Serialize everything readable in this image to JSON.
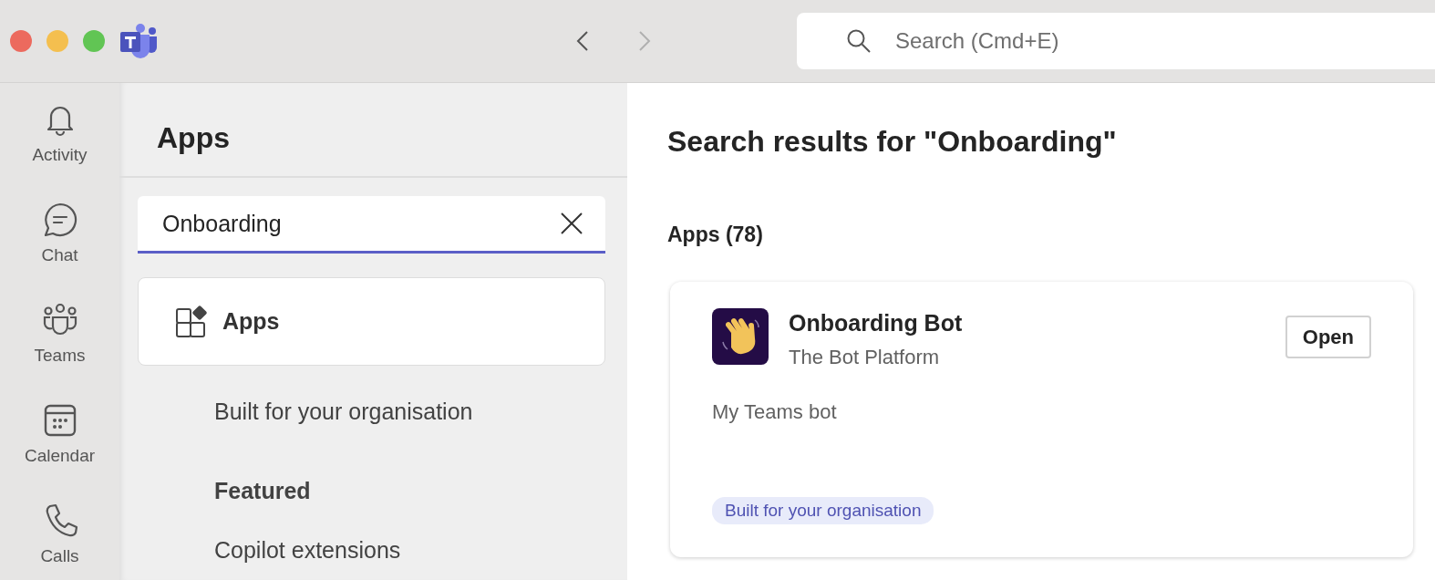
{
  "title_bar": {
    "nav_buttons": [
      {
        "kind": "back",
        "disabled": false
      },
      {
        "kind": "forward",
        "disabled": true
      }
    ],
    "search": {
      "placeholder": "Search (Cmd+E)"
    }
  },
  "rail": {
    "items": [
      {
        "kind": "activity",
        "label": "Activity"
      },
      {
        "kind": "chat",
        "label": "Chat"
      },
      {
        "kind": "teams",
        "label": "Teams"
      },
      {
        "kind": "calendar",
        "label": "Calendar"
      },
      {
        "kind": "calls",
        "label": "Calls"
      }
    ]
  },
  "sidebar": {
    "title": "Apps",
    "search": {
      "value": "Onboarding"
    },
    "items": [
      {
        "kind": "card",
        "label": "Apps",
        "selected": true
      },
      {
        "kind": "item",
        "label": "Built for your organisation",
        "selected": false
      },
      {
        "kind": "heading",
        "label": "Featured"
      },
      {
        "kind": "item",
        "label": "Copilot extensions",
        "selected": false
      }
    ]
  },
  "main": {
    "title": "Search results for \"Onboarding\"",
    "section": "Apps (78)",
    "results": [
      {
        "name": "Onboarding Bot",
        "publisher": "The Bot Platform",
        "description": "My Teams bot",
        "action": "Open",
        "tag": "Built for your organisation"
      }
    ]
  }
}
